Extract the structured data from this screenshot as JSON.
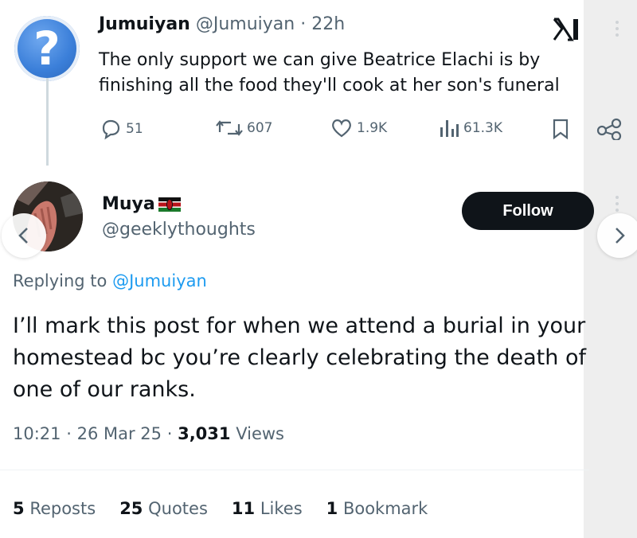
{
  "original_tweet": {
    "avatar_glyph": "?",
    "author_name": "Jumuiyan",
    "author_handle": "@Jumuiyan",
    "separator": "·",
    "time_ago": "22h",
    "text": "The only support we can give Beatrice Elachi is by finishing all the food they'll cook at her son's funeral",
    "actions": {
      "replies": "51",
      "reposts": "607",
      "likes": "1.9K",
      "views": "61.3K"
    }
  },
  "reply_tweet": {
    "author_name": "Muya",
    "author_handle": "@geeklythoughts",
    "follow_label": "Follow",
    "replying_prefix": "Replying to",
    "replying_to": "@Jumuiyan",
    "text": "I’ll mark this post for when we attend a burial in your homestead bc you’re clearly celebrating the death of one of our ranks.",
    "time": "10:21",
    "date": "26 Mar 25",
    "separator": "·",
    "views_count": "3,031",
    "views_label": "Views"
  },
  "stats": {
    "reposts_count": "5",
    "reposts_label": "Reposts",
    "quotes_count": "25",
    "quotes_label": "Quotes",
    "likes_count": "11",
    "likes_label": "Likes",
    "bookmarks_count": "1",
    "bookmarks_label": "Bookmark"
  },
  "icons": {
    "reply": "reply-icon",
    "repost": "repost-icon",
    "like": "heart-icon",
    "views": "views-icon",
    "bookmark": "bookmark-icon",
    "share": "share-icon",
    "watermark": "x-logo-icon",
    "carousel_prev": "chevron-left-icon",
    "carousel_next": "chevron-right-icon"
  },
  "colors": {
    "text_primary": "#0f1419",
    "text_secondary": "#536471",
    "link": "#1d9bf0",
    "follow_bg": "#0f1419",
    "avatar_blue": "#3b7fd9"
  }
}
